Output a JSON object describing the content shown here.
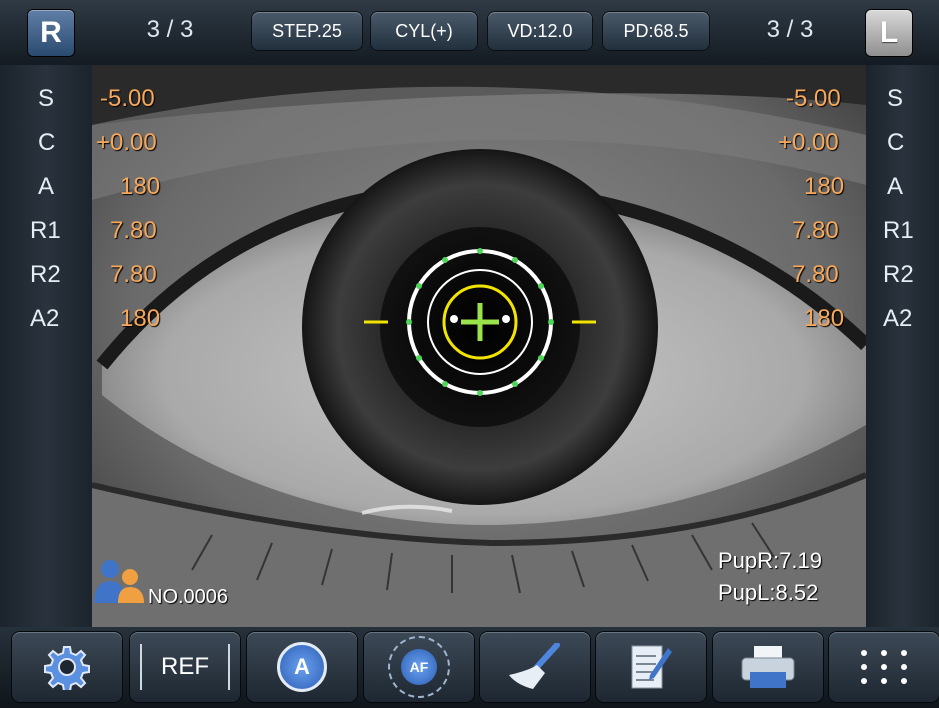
{
  "header": {
    "right_eye_label": "R",
    "left_eye_label": "L",
    "right_count": "3 / 3",
    "left_count": "3 / 3",
    "buttons": [
      {
        "label": "STEP.25"
      },
      {
        "label": "CYL(+)"
      },
      {
        "label": "VD:12.0"
      },
      {
        "label": "PD:68.5"
      }
    ]
  },
  "measurement_labels": [
    "S",
    "C",
    "A",
    "R1",
    "R2",
    "A2"
  ],
  "right_values": [
    "-5.00",
    "+0.00",
    "180",
    "7.80",
    "7.80",
    "180"
  ],
  "left_values": [
    "-5.00",
    "+0.00",
    "180",
    "7.80",
    "7.80",
    "180"
  ],
  "pupil": {
    "right": "PupR:7.19",
    "left": "PupL:8.52"
  },
  "patient": {
    "number": "NO.0006",
    "icon": "patients-icon"
  },
  "toolbar": {
    "items": [
      {
        "icon": "gear-icon"
      },
      {
        "icon": "ref-icon",
        "label": "REF"
      },
      {
        "icon": "auto-mode-icon",
        "label": "A"
      },
      {
        "icon": "autofocus-icon",
        "label": "AF"
      },
      {
        "icon": "broom-icon"
      },
      {
        "icon": "notepad-icon"
      },
      {
        "icon": "printer-icon"
      },
      {
        "icon": "menu-grid-icon"
      }
    ]
  },
  "colors": {
    "value_text": "#f7a85a",
    "reticle_yellow": "#f2e400",
    "reticle_green": "#7ed957",
    "accent_blue": "#3f74c8"
  }
}
